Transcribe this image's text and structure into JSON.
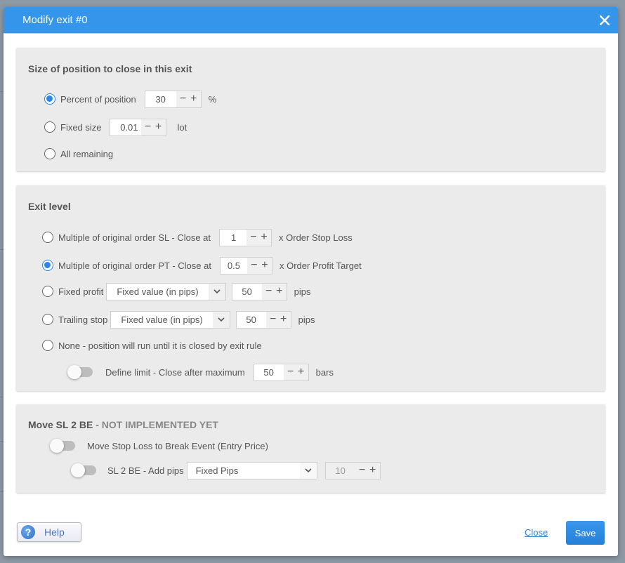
{
  "dialog": {
    "title": "Modify exit #0",
    "close_icon": "close-x-icon"
  },
  "size_section": {
    "title": "Size of position to close in this exit",
    "options": [
      {
        "label": "Percent of position",
        "checked": true,
        "value": "30",
        "unit": "%"
      },
      {
        "label": "Fixed size",
        "checked": false,
        "value": "0.01",
        "unit": "lot"
      },
      {
        "label": "All remaining",
        "checked": false
      }
    ]
  },
  "exit_level_section": {
    "title": "Exit level",
    "sl_multiple": {
      "label": "Multiple of original order SL - Close at",
      "checked": false,
      "value": "1",
      "unit": "x Order Stop Loss"
    },
    "pt_multiple": {
      "label": "Multiple of original order PT - Close at",
      "checked": true,
      "value": "0.5",
      "unit": "x Order Profit Target"
    },
    "fixed_profit": {
      "label": "Fixed profit",
      "checked": false,
      "select": "Fixed value (in pips)",
      "value": "50",
      "unit": "pips"
    },
    "trailing_stop": {
      "label": "Trailing stop",
      "checked": false,
      "select": "Fixed value (in pips)",
      "value": "50",
      "unit": "pips"
    },
    "none": {
      "label": "None - position will run until it is closed by exit rule",
      "checked": false
    },
    "define_limit": {
      "label": "Define limit - Close after maximum",
      "enabled": false,
      "value": "50",
      "unit": "bars"
    }
  },
  "move_sl_section": {
    "title": "Move SL 2 BE",
    "title_warning": " - NOT IMPLEMENTED YET",
    "move_sl": {
      "label": "Move Stop Loss to Break Event (Entry Price)",
      "enabled": false
    },
    "add_pips": {
      "label": "SL 2 BE - Add pips",
      "enabled": false,
      "select": "Fixed Pips",
      "value": "10"
    }
  },
  "stepper": {
    "minus": "−",
    "plus": "+"
  },
  "footer": {
    "help_label": "Help",
    "help_icon_glyph": "?",
    "close_label": "Close",
    "save_label": "Save"
  },
  "colors": {
    "header_bg": "#3595eb",
    "accent": "#2b87e3",
    "section_bg": "#ebebeb",
    "overlay_bg": "#8e99a6"
  }
}
